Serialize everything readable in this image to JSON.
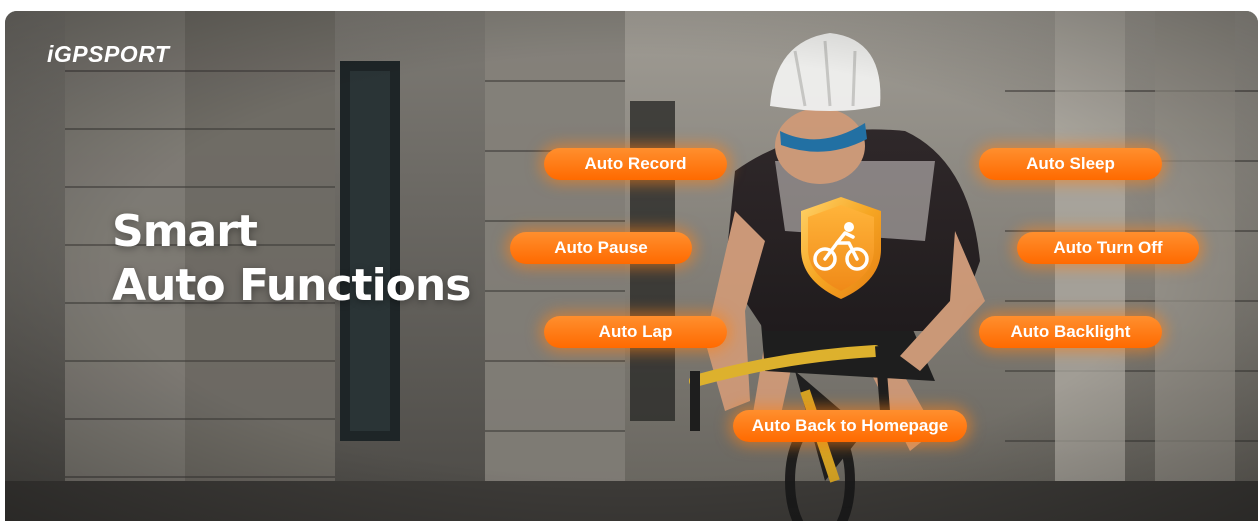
{
  "brand": {
    "logo_text": "iGPSPORT"
  },
  "headline": {
    "line1": "Smart",
    "line2": "Auto Functions"
  },
  "features": [
    "Auto Record",
    "Auto Pause",
    "Auto Lap",
    "Auto Sleep",
    "Auto Turn Off",
    "Auto Backlight",
    "Auto Back to Homepage"
  ],
  "colors": {
    "pill_orange": "#FF7A1A",
    "pill_orange_dark": "#FF5A00",
    "shield_gold": "#F6A623",
    "headline_text": "#FFFFFF"
  },
  "icons": {
    "shield": "cycling-shield-icon"
  }
}
